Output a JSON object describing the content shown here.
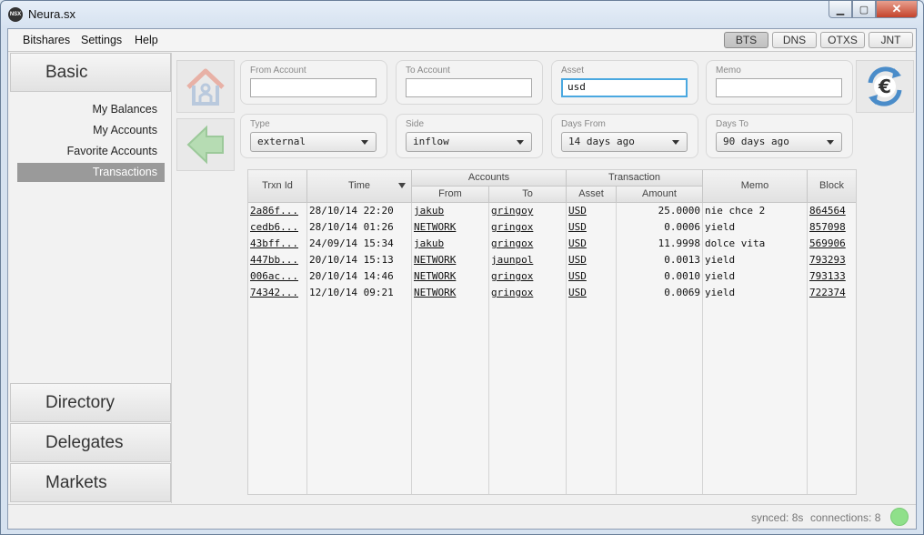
{
  "window": {
    "title": "Neura.sx",
    "app_icon_text": "NSX"
  },
  "menu": [
    "Bitshares",
    "Settings",
    "Help"
  ],
  "network_tabs": [
    {
      "label": "BTS",
      "active": true
    },
    {
      "label": "DNS",
      "active": false
    },
    {
      "label": "OTXS",
      "active": false
    },
    {
      "label": "JNT",
      "active": false
    }
  ],
  "sidebar": {
    "basic": "Basic",
    "items": [
      "My Balances",
      "My Accounts",
      "Favorite Accounts",
      "Transactions"
    ],
    "active_item": "Transactions",
    "sections": [
      "Directory",
      "Delegates",
      "Markets"
    ]
  },
  "filters": {
    "from_account": {
      "label": "From Account",
      "value": ""
    },
    "to_account": {
      "label": "To Account",
      "value": ""
    },
    "asset": {
      "label": "Asset",
      "value": "usd"
    },
    "memo": {
      "label": "Memo",
      "value": ""
    },
    "type": {
      "label": "Type",
      "value": "external"
    },
    "side": {
      "label": "Side",
      "value": "inflow"
    },
    "days_from": {
      "label": "Days From",
      "value": "14 days ago"
    },
    "days_to": {
      "label": "Days To",
      "value": "90 days ago"
    }
  },
  "table": {
    "headers": {
      "trxn_id": "Trxn Id",
      "time": "Time",
      "accounts": "Accounts",
      "from": "From",
      "to": "To",
      "transaction": "Transaction",
      "asset": "Asset",
      "amount": "Amount",
      "memo": "Memo",
      "block": "Block"
    },
    "rows": [
      {
        "id": "2a86f...",
        "time": "28/10/14 22:20",
        "from": "jakub",
        "to": "gringoy",
        "asset": "USD",
        "amount": "25.0000",
        "memo": "nie chce 2",
        "block": "864564"
      },
      {
        "id": "cedb6...",
        "time": "28/10/14 01:26",
        "from": "NETWORK",
        "to": "gringox",
        "asset": "USD",
        "amount": "0.0006",
        "memo": "yield",
        "block": "857098"
      },
      {
        "id": "43bff...",
        "time": "24/09/14 15:34",
        "from": "jakub",
        "to": "gringox",
        "asset": "USD",
        "amount": "11.9998",
        "memo": "dolce vita",
        "block": "569906"
      },
      {
        "id": "447bb...",
        "time": "20/10/14 15:13",
        "from": "NETWORK",
        "to": "jaunpol",
        "asset": "USD",
        "amount": "0.0013",
        "memo": "yield",
        "block": "793293"
      },
      {
        "id": "006ac...",
        "time": "20/10/14 14:46",
        "from": "NETWORK",
        "to": "gringox",
        "asset": "USD",
        "amount": "0.0010",
        "memo": "yield",
        "block": "793133"
      },
      {
        "id": "74342...",
        "time": "12/10/14 09:21",
        "from": "NETWORK",
        "to": "gringox",
        "asset": "USD",
        "amount": "0.0069",
        "memo": "yield",
        "block": "722374"
      }
    ]
  },
  "status": {
    "synced": "synced: 8s",
    "connections": "connections: 8",
    "indicator_color": "#8fe08a"
  }
}
